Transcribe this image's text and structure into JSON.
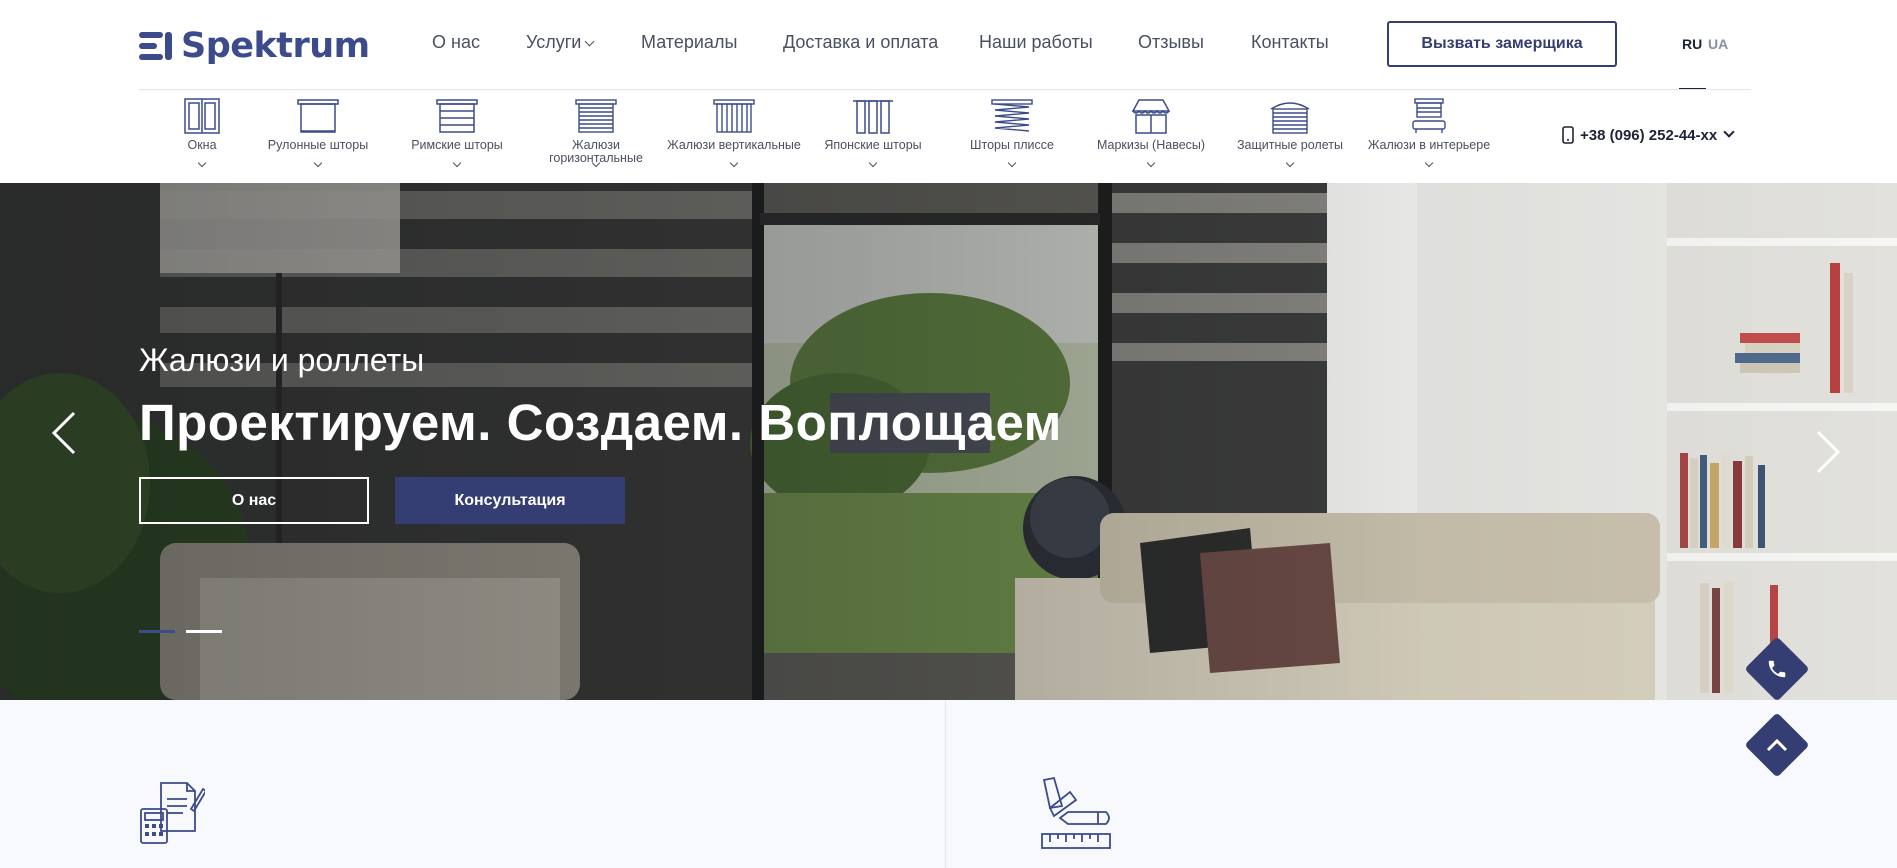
{
  "brand": {
    "name": "Spektrum",
    "accent": "#343e73"
  },
  "nav": {
    "items": [
      {
        "label": "О нас"
      },
      {
        "label": "Услуги",
        "has_dropdown": true
      },
      {
        "label": "Материалы"
      },
      {
        "label": "Доставка и оплата"
      },
      {
        "label": "Наши работы"
      },
      {
        "label": "Отзывы"
      },
      {
        "label": "Контакты"
      }
    ],
    "cta_label": "Вызвать замерщика"
  },
  "languages": {
    "active": "RU",
    "other": "UA"
  },
  "categories": [
    {
      "label": "Окна",
      "icon": "window-icon"
    },
    {
      "label": "Рулонные шторы",
      "icon": "roller-blind-icon"
    },
    {
      "label": "Римские шторы",
      "icon": "roman-blind-icon"
    },
    {
      "label": "Жалюзи горизонтальные",
      "icon": "horizontal-blinds-icon"
    },
    {
      "label": "Жалюзи вертикальные",
      "icon": "vertical-blinds-icon"
    },
    {
      "label": "Японские шторы",
      "icon": "japanese-panel-icon"
    },
    {
      "label": "Шторы плиссе",
      "icon": "pleated-blind-icon"
    },
    {
      "label": "Маркизы (Навесы)",
      "icon": "awning-icon"
    },
    {
      "label": "Защитные ролеты",
      "icon": "shutter-icon"
    },
    {
      "label": "Жалюзи в интерьере",
      "icon": "interior-icon"
    }
  ],
  "phone": {
    "number": "+38 (096) 252-44-xx"
  },
  "hero": {
    "subtitle": "Жалюзи и роллеты",
    "title": "Проектируем. Создаем. Воплощаем",
    "button_about": "О нас",
    "button_consult": "Консультация",
    "slides_total": 2,
    "slide_active": 1
  },
  "features": [
    {
      "icon": "documents-calculator-icon"
    },
    {
      "icon": "design-tools-icon"
    }
  ],
  "floating": {
    "call_icon": "phone-icon",
    "top_icon": "chevron-up-icon"
  }
}
